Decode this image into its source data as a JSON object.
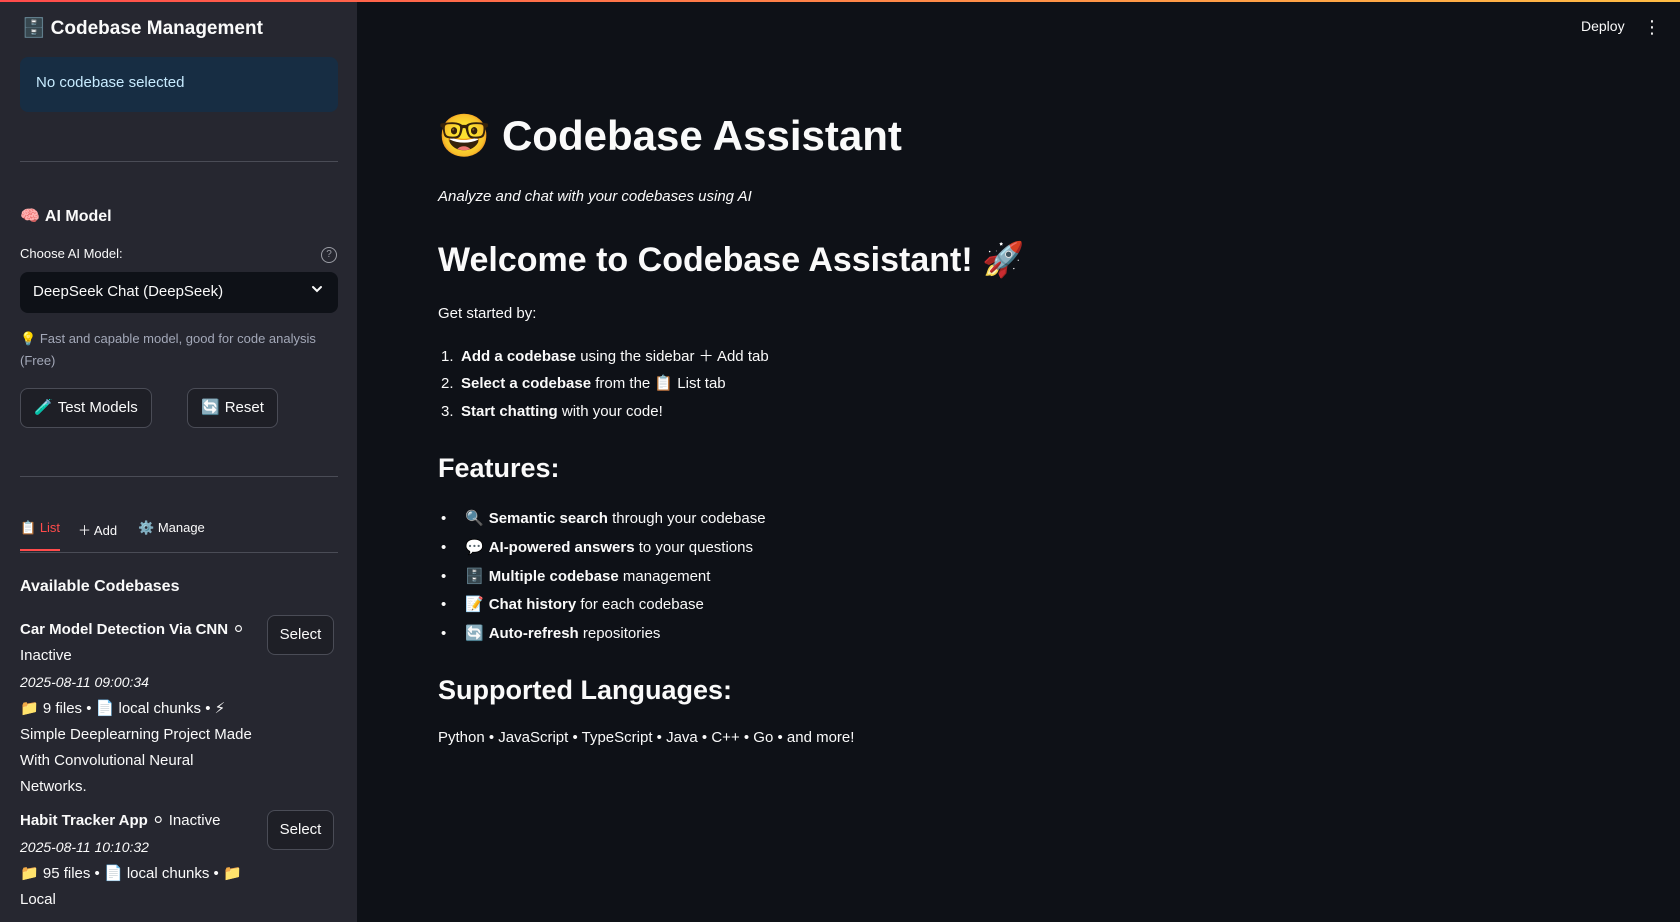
{
  "sidebar": {
    "title_icon": "🗄️",
    "title": "Codebase Management",
    "status_info": "No codebase selected",
    "ai_model": {
      "heading_icon": "🧠",
      "heading": "AI Model",
      "choose_label": "Choose AI Model:",
      "help_icon": "?",
      "selected_model": "DeepSeek Chat (DeepSeek)",
      "caption_icon": "💡",
      "caption": "Fast and capable model, good for code analysis (Free)",
      "test_models_icon": "🧪",
      "test_models_label": "Test Models",
      "reset_icon": "🔄",
      "reset_label": "Reset"
    },
    "tabs": [
      {
        "icon": "📋",
        "label": "List",
        "active": true
      },
      {
        "icon": "＋",
        "label": "Add",
        "active": false
      },
      {
        "icon": "⚙️",
        "label": "Manage",
        "active": false
      }
    ],
    "available_heading": "Available Codebases",
    "codebases": [
      {
        "name": "Car Model Detection Via CNN",
        "status_icon": "⚪",
        "status": "Inactive",
        "timestamp": "2025-08-11 09:00:34",
        "files_icon": "📁",
        "files": "9 files",
        "chunks_icon": "📄",
        "chunks": "local chunks",
        "extra_icon": "⚡",
        "description": "Simple Deeplearning Project Made With Convolutional Neural Networks.",
        "select_label": "Select"
      },
      {
        "name": "Habit Tracker App",
        "status_icon": "⚪",
        "status": "Inactive",
        "timestamp": "2025-08-11 10:10:32",
        "files_icon": "📁",
        "files": "95 files",
        "chunks_icon": "📄",
        "chunks": "local chunks",
        "extra_icon": "📁",
        "description": "Local",
        "select_label": "Select"
      }
    ]
  },
  "header": {
    "deploy_label": "Deploy",
    "menu_icon": "⋮"
  },
  "main": {
    "title_icon": "🤓",
    "title": "Codebase Assistant",
    "subtitle": "Analyze and chat with your codebases using AI",
    "welcome": "Welcome to Codebase Assistant! 🚀",
    "get_started": "Get started by:",
    "steps": [
      {
        "num": "1.",
        "bold": "Add a codebase",
        "rest": " using the sidebar ＋ Add tab"
      },
      {
        "num": "2.",
        "bold": "Select a codebase",
        "rest": " from the 📋 List tab"
      },
      {
        "num": "3.",
        "bold": "Start chatting",
        "rest": " with your code!"
      }
    ],
    "features_heading": "Features:",
    "features": [
      {
        "icon": "🔍",
        "bold": "Semantic search",
        "rest": " through your codebase"
      },
      {
        "icon": "💬",
        "bold": "AI-powered answers",
        "rest": " to your questions"
      },
      {
        "icon": "🗄️",
        "bold": "Multiple codebase",
        "rest": " management"
      },
      {
        "icon": "📝",
        "bold": "Chat history",
        "rest": " for each codebase"
      },
      {
        "icon": "🔄",
        "bold": "Auto-refresh",
        "rest": " repositories"
      }
    ],
    "languages_heading": "Supported Languages:",
    "languages": "Python • JavaScript • TypeScript • Java • C++ • Go • and more!"
  },
  "colors": {
    "background": "#0e1117",
    "sidebar": "#262730",
    "accent": "#ff4b4b",
    "info_bg": "#172d43",
    "info_text": "#c7ebff"
  }
}
